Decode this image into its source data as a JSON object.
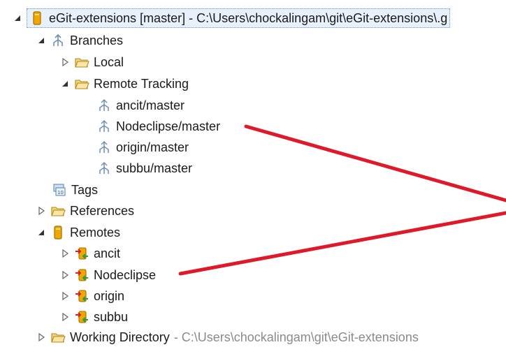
{
  "tree": {
    "root": {
      "label": "eGit-extensions [master] - C:\\Users\\chockalingam\\git\\eGit-extensions\\.g"
    },
    "branches": {
      "label": "Branches"
    },
    "local": {
      "label": "Local"
    },
    "remote_tracking": {
      "label": "Remote Tracking"
    },
    "remote_branches": [
      "ancit/master",
      "Nodeclipse/master",
      "origin/master",
      "subbu/master"
    ],
    "tags": {
      "label": "Tags"
    },
    "references": {
      "label": "References"
    },
    "remotes": {
      "label": "Remotes"
    },
    "remote_items": [
      "ancit",
      "Nodeclipse",
      "origin",
      "subbu"
    ],
    "working_dir": {
      "label": "Working Directory",
      "path": "- C:\\Users\\chockalingam\\git\\eGit-extensions"
    }
  },
  "colors": {
    "annotation_line": "#e0192a",
    "folder": "#e7b84a",
    "repo": "#f0a800",
    "branch": "#6f8fb8",
    "selection": "#e8f0fb"
  },
  "icons": {
    "expanded": "triangle-expanded-icon",
    "collapsed": "triangle-collapsed-icon",
    "repo": "repository-icon",
    "branches": "branches-icon",
    "folder": "folder-icon",
    "branch": "branch-icon",
    "tags": "tags-icon",
    "remote": "remote-icon"
  }
}
